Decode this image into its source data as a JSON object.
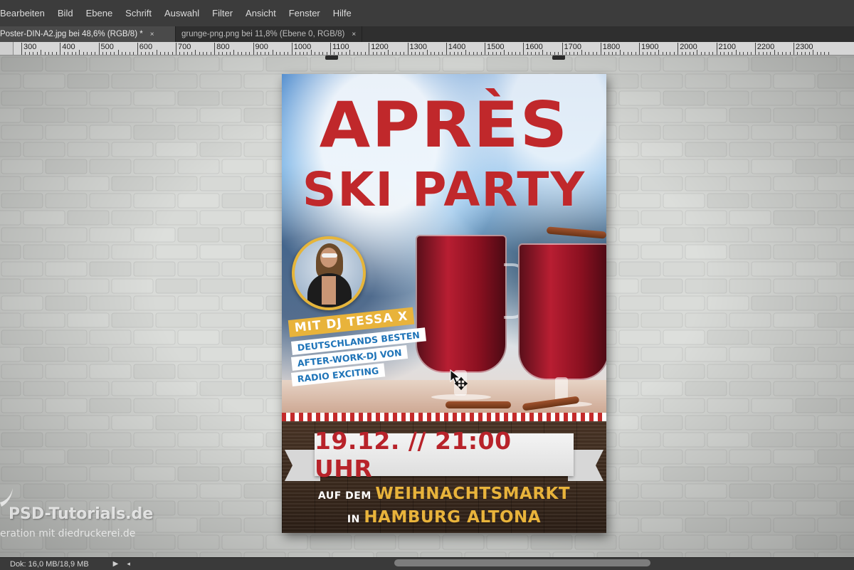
{
  "menu": {
    "items": [
      "Bearbeiten",
      "Bild",
      "Ebene",
      "Schrift",
      "Auswahl",
      "Filter",
      "Ansicht",
      "Fenster",
      "Hilfe"
    ]
  },
  "tabs": [
    {
      "label": "Poster-DIN-A2.jpg bei 48,6% (RGB/8) *",
      "close": "×",
      "active": true
    },
    {
      "label": "grunge-png.png bei 11,8% (Ebene 0, RGB/8)",
      "close": "×",
      "active": false
    }
  ],
  "ruler": {
    "labels": [
      "300",
      "400",
      "500",
      "600",
      "700",
      "800",
      "900",
      "1000",
      "1100",
      "1200",
      "1300",
      "1400",
      "1500",
      "1600",
      "1700",
      "1800",
      "1900",
      "2000",
      "2100",
      "2200",
      "2300"
    ]
  },
  "poster": {
    "title_line1": "APRÈS",
    "title_line2": "SKI PARTY",
    "dj_name": "MIT DJ TESSA X",
    "dj_lines": [
      "DEUTSCHLANDS BESTEN",
      "AFTER-WORK-DJ VON",
      "RADIO EXCITING"
    ],
    "date_time": "19.12. // 21:00 UHR",
    "location_prefix1": "AUF DEM",
    "location_1": "WEIHNACHTSMARKT",
    "location_prefix2": "IN",
    "location_2": "HAMBURG ALTONA",
    "colors": {
      "title_red": "#c0282b",
      "accent_yellow": "#e8b33b",
      "text_blue": "#1f74b8"
    }
  },
  "watermark": {
    "title": "PSD-Tutorials.de",
    "subtitle": "eration mit  diedruckerei.de"
  },
  "status": {
    "doc": "Dok: 16,0 MB/18,9 MB",
    "arrow": "▶",
    "arrow2": "◂"
  },
  "icons": [
    "move-cursor-icon",
    "close-icon",
    "play-arrow-icon"
  ]
}
